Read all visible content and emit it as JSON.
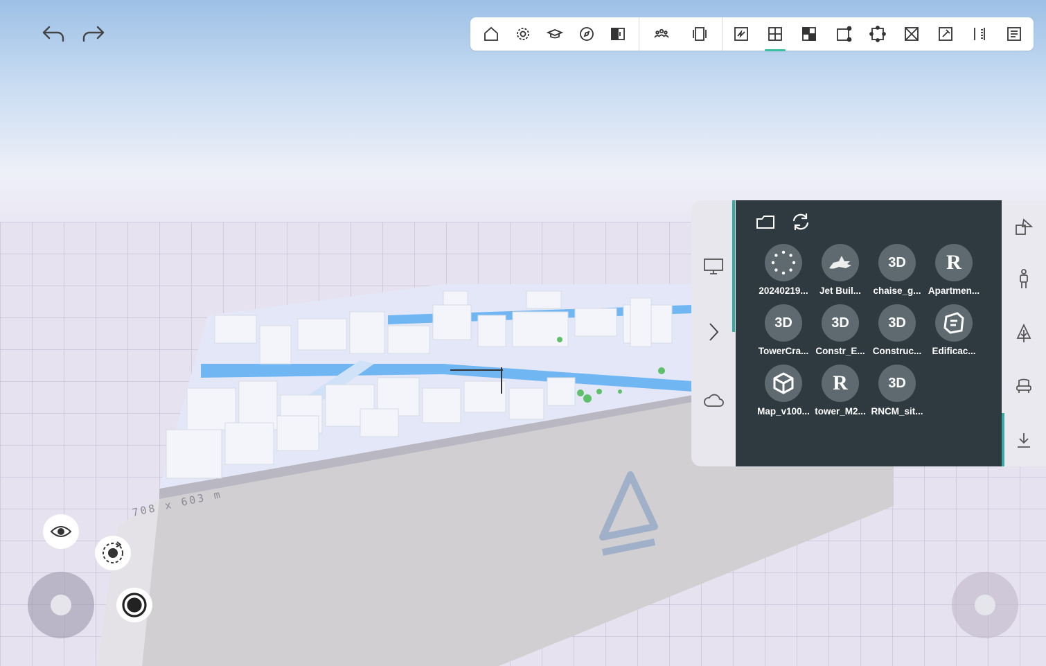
{
  "history": {
    "undo_icon": "undo-icon",
    "redo_icon": "redo-icon"
  },
  "toolbar": {
    "groups": [
      [
        "home-icon",
        "settings-icon",
        "graduation-cap-icon",
        "compass-icon",
        "split-view-icon"
      ],
      [
        "people-icon",
        "panels-icon"
      ],
      [
        "sketch-icon",
        "grid-plus-icon",
        "checker-icon",
        "rect-node-icon",
        "select-frame-icon",
        "cross-box-icon",
        "pin-box-icon",
        "ruler-split-icon",
        "list-doc-icon"
      ]
    ],
    "active": "grid-plus-icon",
    "accent_color": "#3bbfa3"
  },
  "scene": {
    "dimension_label": "708 x 603 m"
  },
  "panel": {
    "left_tabs": [
      "monitor-icon",
      "chevron-right-icon",
      "cloud-icon"
    ],
    "header_icons": [
      "folder-icon",
      "refresh-icon"
    ],
    "files": [
      {
        "label": "20240219...",
        "type": "dots"
      },
      {
        "label": "Jet Buil...",
        "type": "rhino"
      },
      {
        "label": "chaise_g...",
        "type": "3d",
        "text": "3D"
      },
      {
        "label": "Apartmen...",
        "type": "revit",
        "text": "R"
      },
      {
        "label": "TowerCra...",
        "type": "3d",
        "text": "3D"
      },
      {
        "label": "Constr_E...",
        "type": "3d",
        "text": "3D"
      },
      {
        "label": "Construc...",
        "type": "3d",
        "text": "3D"
      },
      {
        "label": "Edificac...",
        "type": "sketchup"
      },
      {
        "label": "Map_v100...",
        "type": "unity"
      },
      {
        "label": "tower_M2...",
        "type": "revit",
        "text": "R"
      },
      {
        "label": "RNCM_sit...",
        "type": "3d",
        "text": "3D"
      }
    ],
    "right_tabs": [
      "shapes-icon",
      "person-icon",
      "tree-icon",
      "chair-icon",
      "download-icon"
    ],
    "accent_color": "#3aa7a0",
    "bg_color": "#2e3a40"
  },
  "controls": {
    "eye": "eye-icon",
    "orbit": "orbit-icon",
    "record": "record-icon",
    "left_joystick": "left-joystick",
    "right_joystick": "right-joystick"
  }
}
